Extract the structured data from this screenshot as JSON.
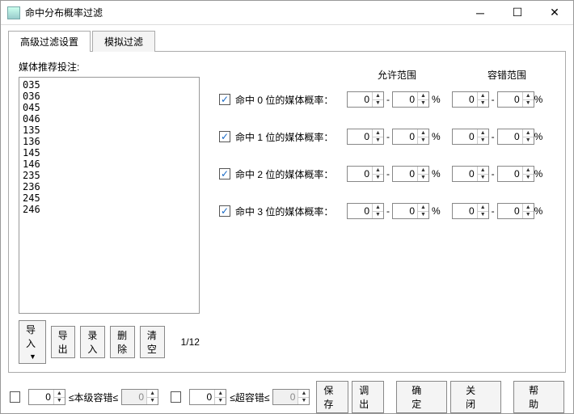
{
  "title": "命中分布概率过滤",
  "tabs": [
    {
      "label": "高级过滤设置",
      "active": true
    },
    {
      "label": "模拟过滤",
      "active": false
    }
  ],
  "left": {
    "label": "媒体推荐投注:",
    "items": [
      "035",
      "036",
      "045",
      "046",
      "135",
      "136",
      "145",
      "146",
      "235",
      "236",
      "245",
      "246"
    ],
    "buttons": {
      "import": "导入",
      "export": "导出",
      "record": "录入",
      "delete": "删除",
      "clear": "清空"
    },
    "page": "1/12"
  },
  "headers": {
    "allow": "允许范围",
    "fault": "容错范围"
  },
  "rows": [
    {
      "checked": true,
      "label": "命中 0 位的媒体概率：",
      "a1": "0",
      "a2": "0",
      "f1": "0",
      "f2": "0"
    },
    {
      "checked": true,
      "label": "命中 1 位的媒体概率：",
      "a1": "0",
      "a2": "0",
      "f1": "0",
      "f2": "0"
    },
    {
      "checked": true,
      "label": "命中 2 位的媒体概率：",
      "a1": "0",
      "a2": "0",
      "f1": "0",
      "f2": "0"
    },
    {
      "checked": true,
      "label": "命中 3 位的媒体概率：",
      "a1": "0",
      "a2": "0",
      "f1": "0",
      "f2": "0"
    }
  ],
  "footer": {
    "cb1": false,
    "v1": "0",
    "t1": "≤本级容错≤",
    "v2": "0",
    "cb2": false,
    "v3": "0",
    "t2": "≤超容错≤",
    "v4": "0",
    "save": "保存",
    "load": "调出",
    "ok": "确 定",
    "close": "关 闭",
    "help": "帮 助"
  },
  "pct": "%"
}
